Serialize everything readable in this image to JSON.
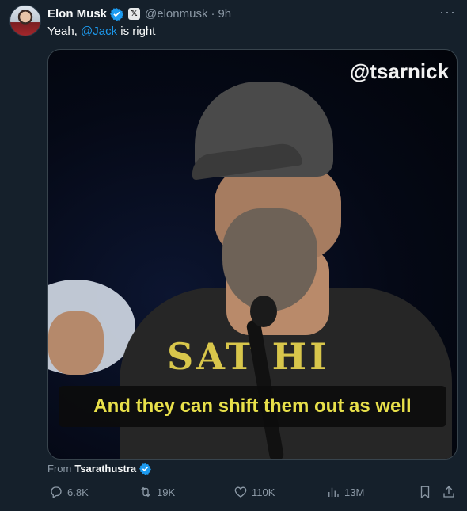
{
  "tweet": {
    "author_name": "Elon Musk",
    "handle": "@elonmusk",
    "separator": "·",
    "time": "9h",
    "more": "···",
    "text_before": "Yeah, ",
    "mention": "@Jack",
    "text_after": " is right",
    "verified_icon": "verified-badge-icon",
    "affiliation_icon": "x-logo-icon",
    "affiliation_glyph": "𝕏"
  },
  "media": {
    "watermark": "@tsarnick",
    "caption": "And they can shift them out as well",
    "shirt_print": "SAT  HI"
  },
  "source": {
    "prefix": "From",
    "name": "Tsarathustra"
  },
  "actions": {
    "replies": "6.8K",
    "reposts": "19K",
    "likes": "110K",
    "views": "13M"
  },
  "colors": {
    "background": "#15202b",
    "accent": "#1d9bf0",
    "muted": "#8b98a5",
    "caption_text": "#e8e04a"
  }
}
